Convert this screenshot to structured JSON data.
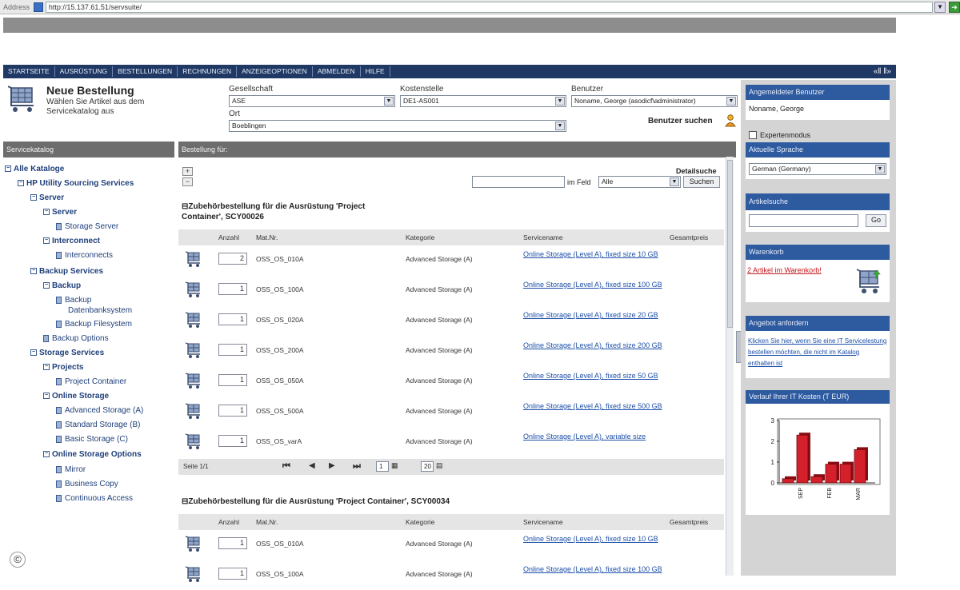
{
  "browser": {
    "address_label": "Address",
    "url": "http://15.137.61.51/servsuite/"
  },
  "nav": {
    "items": [
      "STARTSEITE",
      "AUSRÜSTUNG",
      "BESTELLUNGEN",
      "RECHNUNGEN",
      "ANZEIGEOPTIONEN",
      "ABMELDEN",
      "HILFE"
    ],
    "arrows": "«| |»"
  },
  "header": {
    "title": "Neue Bestellung",
    "subtitle": "Wählen Sie Artikel aus dem Servicekatalog aus",
    "gesellschaft_label": "Gesellschaft",
    "gesellschaft_value": "ASE",
    "kostenstelle_label": "Kostenstelle",
    "kostenstelle_value": "DE1-AS001",
    "benutzer_label": "Benutzer",
    "benutzer_value": "Noname, George (asodicf\\administrator)",
    "ort_label": "Ort",
    "ort_value": "Boeblingen",
    "user_search": "Benutzer suchen"
  },
  "catalog": {
    "title": "Servicekatalog",
    "nodes": [
      {
        "label": "Alle Kataloge",
        "bold": true,
        "type": "folder"
      },
      {
        "label": "HP Utility Sourcing Services",
        "bold": true,
        "type": "folder"
      },
      {
        "label": "Server",
        "bold": true,
        "type": "folder"
      },
      {
        "label": "Server",
        "bold": true,
        "type": "folder"
      },
      {
        "label": "Storage Server",
        "bold": false,
        "type": "doc"
      },
      {
        "label": "Interconnect",
        "bold": true,
        "type": "folder"
      },
      {
        "label": "Interconnects",
        "bold": false,
        "type": "doc"
      },
      {
        "label": "Backup Services",
        "bold": true,
        "type": "folder"
      },
      {
        "label": "Backup",
        "bold": true,
        "type": "folder"
      },
      {
        "label": "Backup",
        "bold": false,
        "type": "doc"
      },
      {
        "label": "Datenbanksystem",
        "bold": false,
        "type": "cont"
      },
      {
        "label": "Backup Filesystem",
        "bold": false,
        "type": "doc"
      },
      {
        "label": "Backup Options",
        "bold": false,
        "type": "doc"
      },
      {
        "label": "Storage Services",
        "bold": true,
        "type": "folder"
      },
      {
        "label": "Projects",
        "bold": true,
        "type": "folder"
      },
      {
        "label": "Project Container",
        "bold": false,
        "type": "doc"
      },
      {
        "label": "Online Storage",
        "bold": true,
        "type": "folder"
      },
      {
        "label": "Advanced Storage (A)",
        "bold": false,
        "type": "doc"
      },
      {
        "label": "Standard Storage (B)",
        "bold": false,
        "type": "doc"
      },
      {
        "label": "Basic Storage (C)",
        "bold": false,
        "type": "doc"
      },
      {
        "label": "Online Storage Options",
        "bold": true,
        "type": "folder"
      },
      {
        "label": "Mirror",
        "bold": false,
        "type": "doc"
      },
      {
        "label": "Business Copy",
        "bold": false,
        "type": "doc"
      },
      {
        "label": "Continuous Access",
        "bold": false,
        "type": "doc"
      }
    ]
  },
  "order": {
    "title": "Bestellung für:",
    "plus": "+",
    "minus": "−",
    "detailsuche": "Detailsuche",
    "search_value": "",
    "im_feld": "im Feld",
    "field_value": "Alle",
    "search_button": "Suchen",
    "columns": [
      "Anzahl",
      "Mat.Nr.",
      "Kategorie",
      "Servicename",
      "Gesamtpreis"
    ],
    "section1_title": "Zubehörbestellung für die Ausrüstung 'Project Container', SCY00026",
    "section2_title": "Zubehörbestellung für die Ausrüstung 'Project Container', SCY00034",
    "rows1": [
      {
        "qty": "2",
        "mat": "OSS_OS_010A",
        "kat": "Advanced Storage (A)",
        "svc": "Online Storage (Level A), fixed size 10 GB"
      },
      {
        "qty": "1",
        "mat": "OSS_OS_100A",
        "kat": "Advanced Storage (A)",
        "svc": "Online Storage (Level A), fixed size 100 GB"
      },
      {
        "qty": "1",
        "mat": "OSS_OS_020A",
        "kat": "Advanced Storage (A)",
        "svc": "Online Storage (Level A), fixed size 20 GB"
      },
      {
        "qty": "1",
        "mat": "OSS_OS_200A",
        "kat": "Advanced Storage (A)",
        "svc": "Online Storage (Level A), fixed size 200 GB"
      },
      {
        "qty": "1",
        "mat": "OSS_OS_050A",
        "kat": "Advanced Storage (A)",
        "svc": "Online Storage (Level A), fixed size 50 GB"
      },
      {
        "qty": "1",
        "mat": "OSS_OS_500A",
        "kat": "Advanced Storage (A)",
        "svc": "Online Storage (Level A), fixed size 500 GB"
      },
      {
        "qty": "1",
        "mat": "OSS_OS_varA",
        "kat": "Advanced Storage (A)",
        "svc": "Online Storage (Level A), variable size"
      }
    ],
    "rows2": [
      {
        "qty": "1",
        "mat": "OSS_OS_010A",
        "kat": "Advanced Storage (A)",
        "svc": "Online Storage (Level A), fixed size 10 GB"
      },
      {
        "qty": "1",
        "mat": "OSS_OS_100A",
        "kat": "Advanced Storage (A)",
        "svc": "Online Storage (Level A), fixed size 100 GB"
      }
    ],
    "pager": {
      "label": "Seite 1/1",
      "page": "1",
      "per_page": "20"
    }
  },
  "sidebar": {
    "user_title": "Angemeldeter Benutzer",
    "user_name": "Noname, George",
    "expert_mode": "Expertenmodus",
    "lang_title": "Aktuelle Sprache",
    "lang_value": "German (Germany)",
    "article_title": "Artikelsuche",
    "article_value": "",
    "go_button": "Go",
    "cart_title": "Warenkorb",
    "cart_link": "2 Artikel im Warenkorb!",
    "offer_title": "Angebot anfordern",
    "offer_text": "Klicken Sie hier, wenn Sie eine IT Servicelestung bestellen möchten, die nicht im Katalog enthalten ist",
    "cost_title": "Verlauf Ihrer IT Kosten (T EUR)"
  },
  "chart_data": {
    "type": "bar",
    "title": "Verlauf Ihrer IT Kosten (T EUR)",
    "categories": [
      "",
      "SEP",
      "",
      "",
      "",
      "",
      "",
      ""
    ],
    "tick_labels": [
      "SEP",
      "FEB",
      "MAR"
    ],
    "values": [
      0.2,
      2.3,
      0.3,
      0.9,
      0.9,
      1.6
    ],
    "ylim": [
      0,
      3
    ],
    "yticks": [
      "0",
      "1",
      "2",
      "3"
    ],
    "bar_color": "#d4202a",
    "grid": false,
    "legend": "none"
  },
  "colors": {
    "nav_bg": "#1f3864",
    "sidebar_head": "#2e5aa0",
    "link": "#1c4ea8",
    "panel_head": "#6d6d6d"
  },
  "watermark": "©"
}
